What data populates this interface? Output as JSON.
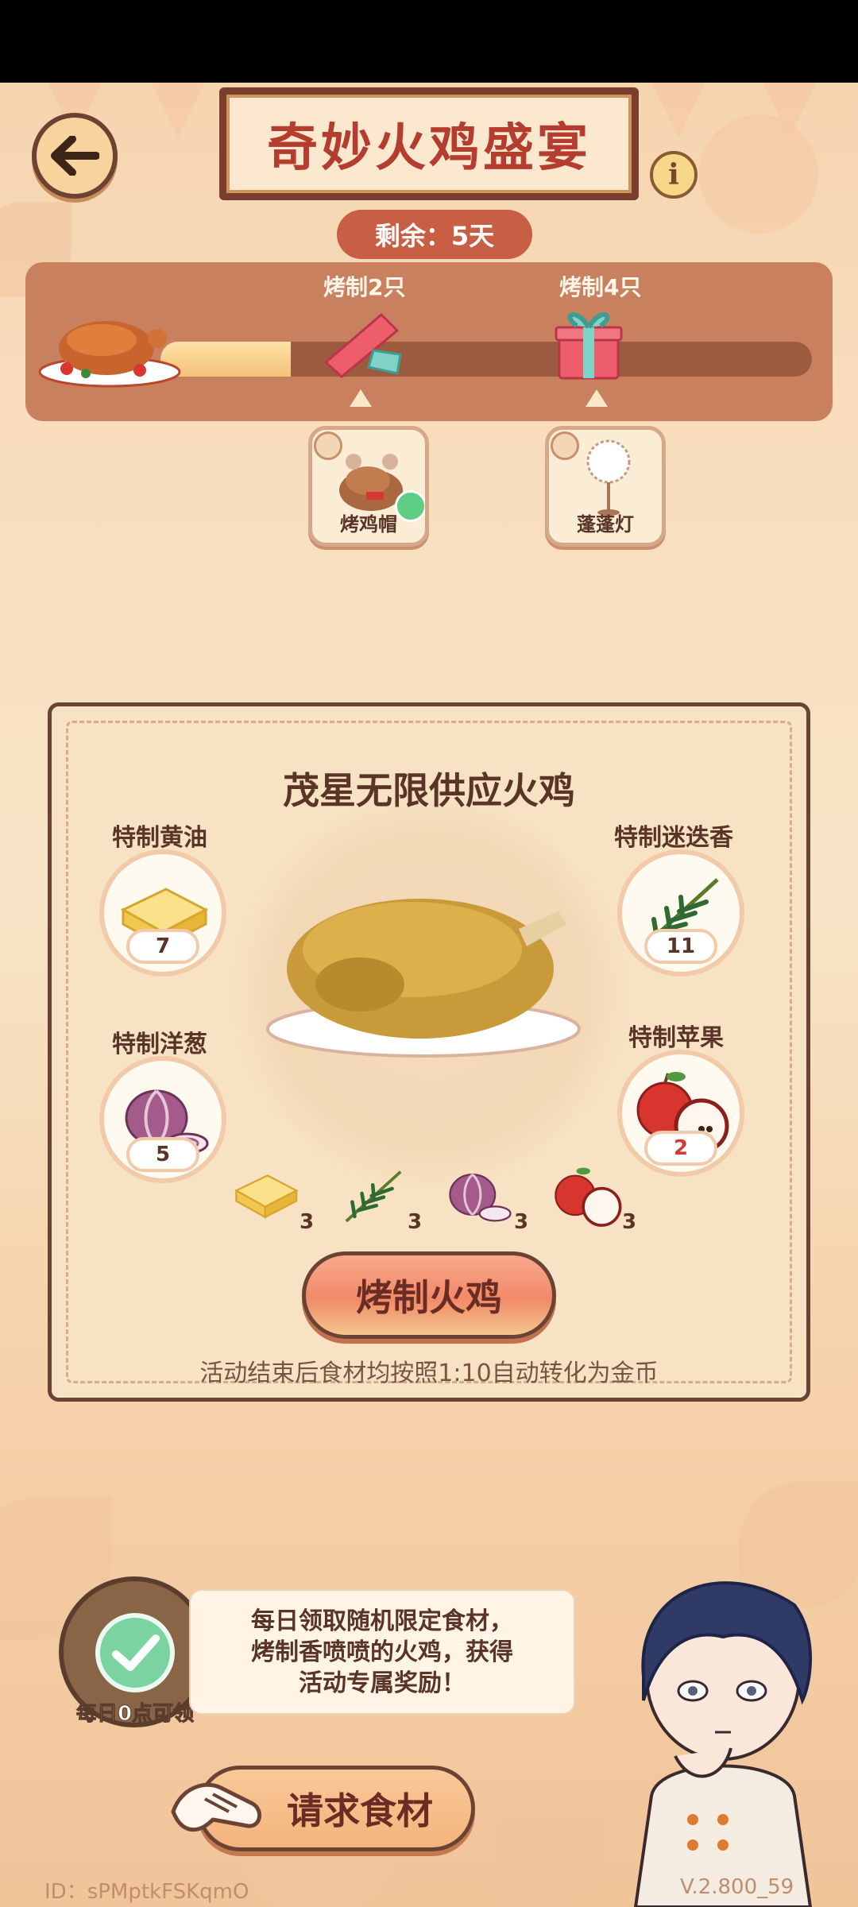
{
  "header": {
    "title": "奇妙火鸡盛宴",
    "remaining_text": "剩余：5天"
  },
  "progress": {
    "fraction": 0.2,
    "milestones": [
      {
        "label": "烤制2只",
        "reward_name": "烤鸡帽",
        "claimed": true
      },
      {
        "label": "烤制4只",
        "reward_name": "蓬蓬灯",
        "claimed": false
      }
    ]
  },
  "panel": {
    "title": "茂星无限供应火鸡",
    "ingredients": [
      {
        "name": "特制黄油",
        "count": "7",
        "low": false,
        "icon": "butter-icon"
      },
      {
        "name": "特制迷迭香",
        "count": "11",
        "low": false,
        "icon": "rosemary-icon"
      },
      {
        "name": "特制洋葱",
        "count": "5",
        "low": false,
        "icon": "onion-icon"
      },
      {
        "name": "特制苹果",
        "count": "2",
        "low": true,
        "icon": "apple-icon"
      }
    ],
    "cost": [
      {
        "icon": "butter-icon",
        "amount": "3"
      },
      {
        "icon": "rosemary-icon",
        "amount": "3"
      },
      {
        "icon": "onion-icon",
        "amount": "3"
      },
      {
        "icon": "apple-icon",
        "amount": "3"
      }
    ],
    "roast_button": "烤制火鸡",
    "footnote": "活动结束后食材均按照1:10自动转化为金币"
  },
  "daily": {
    "badge_label": "每日0点可领",
    "speech_lines": [
      "每日领取随机限定食材，",
      "烤制香喷喷的火鸡，获得",
      "活动专属奖励！"
    ],
    "request_button": "请求食材"
  },
  "footer": {
    "user_id": "ID：sPMptkFSKqmO",
    "version": "V.2.800_59"
  },
  "colors": {
    "accent": "#b53d2f",
    "panel_border": "#6b4334",
    "button": "#f18a68",
    "low_count": "#d23a3a"
  }
}
